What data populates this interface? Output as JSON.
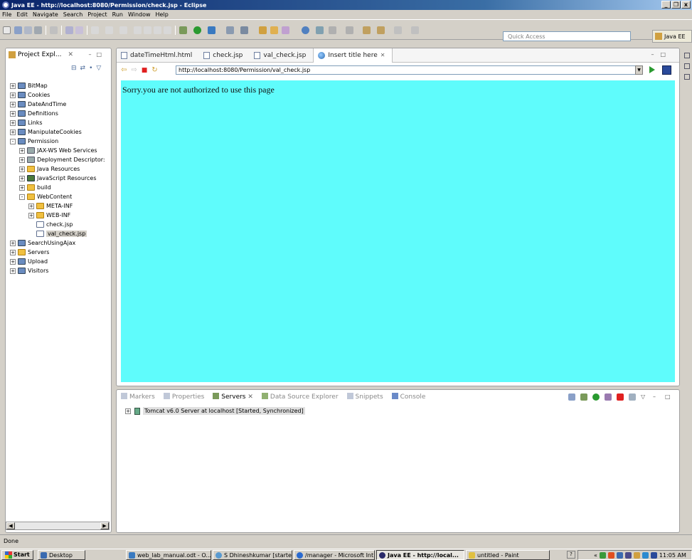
{
  "window": {
    "title": "Java EE - http://localhost:8080/Permission/check.jsp - Eclipse"
  },
  "menu": [
    "File",
    "Edit",
    "Navigate",
    "Search",
    "Project",
    "Run",
    "Window",
    "Help"
  ],
  "toolbar": {
    "quick_access_placeholder": "Quick Access",
    "perspective_label": "Java EE"
  },
  "project_explorer": {
    "title": "Project Expl...",
    "close": "✕",
    "tree": [
      {
        "label": "BitMap",
        "depth": 0,
        "expander": "+",
        "icon": "project"
      },
      {
        "label": "Cookies",
        "depth": 0,
        "expander": "+",
        "icon": "project"
      },
      {
        "label": "DateAndTime",
        "depth": 0,
        "expander": "+",
        "icon": "project"
      },
      {
        "label": "Definitions",
        "depth": 0,
        "expander": "+",
        "icon": "project"
      },
      {
        "label": "Links",
        "depth": 0,
        "expander": "+",
        "icon": "project"
      },
      {
        "label": "ManipulateCookies",
        "depth": 0,
        "expander": "+",
        "icon": "project"
      },
      {
        "label": "Permission",
        "depth": 0,
        "expander": "-",
        "icon": "project"
      },
      {
        "label": "JAX-WS Web Services",
        "depth": 1,
        "expander": "+",
        "icon": "ws"
      },
      {
        "label": "Deployment Descriptor:",
        "depth": 1,
        "expander": "+",
        "icon": "ws"
      },
      {
        "label": "Java Resources",
        "depth": 1,
        "expander": "+",
        "icon": "folder"
      },
      {
        "label": "JavaScript Resources",
        "depth": 1,
        "expander": "+",
        "icon": "js"
      },
      {
        "label": "build",
        "depth": 1,
        "expander": "+",
        "icon": "folder"
      },
      {
        "label": "WebContent",
        "depth": 1,
        "expander": "-",
        "icon": "folder"
      },
      {
        "label": "META-INF",
        "depth": 2,
        "expander": "+",
        "icon": "folder"
      },
      {
        "label": "WEB-INF",
        "depth": 2,
        "expander": "+",
        "icon": "folder"
      },
      {
        "label": "check.jsp",
        "depth": 2,
        "expander": "",
        "icon": "file"
      },
      {
        "label": "val_check.jsp",
        "depth": 2,
        "expander": "",
        "icon": "file",
        "selected": true
      },
      {
        "label": "SearchUsingAjax",
        "depth": 0,
        "expander": "+",
        "icon": "project"
      },
      {
        "label": "Servers",
        "depth": 0,
        "expander": "+",
        "icon": "folder"
      },
      {
        "label": "Upload",
        "depth": 0,
        "expander": "+",
        "icon": "project"
      },
      {
        "label": "Visitors",
        "depth": 0,
        "expander": "+",
        "icon": "project"
      }
    ]
  },
  "editor": {
    "tabs": [
      {
        "label": "dateTimeHtml.html",
        "active": false
      },
      {
        "label": "check.jsp",
        "active": false
      },
      {
        "label": "val_check.jsp",
        "active": false
      },
      {
        "label": "Insert title here",
        "active": true,
        "close": "✕"
      }
    ],
    "url": "http://localhost:8080/Permission/val_check.jsp",
    "page_text": "Sorry.you are not authorized to use this page",
    "page_bg": "#5ffcfc"
  },
  "bottom_panel": {
    "tabs": [
      {
        "label": "Markers",
        "active": false
      },
      {
        "label": "Properties",
        "active": false
      },
      {
        "label": "Servers",
        "active": true,
        "close": "✕"
      },
      {
        "label": "Data Source Explorer",
        "active": false
      },
      {
        "label": "Snippets",
        "active": false
      },
      {
        "label": "Console",
        "active": false
      }
    ],
    "server_entry": "Tomcat v6.0 Server at localhost  [Started, Synchronized]"
  },
  "status": "Done",
  "taskbar": {
    "start": "Start",
    "desktop": "Desktop",
    "tasks": [
      "web_lab_manual.odt - O...",
      "S Dhineshkumar [started...",
      "/manager - Microsoft Int...",
      "Java EE - http://local...",
      "untitled - Paint"
    ],
    "clock": "11:05 AM",
    "tray_prefix": "«"
  }
}
